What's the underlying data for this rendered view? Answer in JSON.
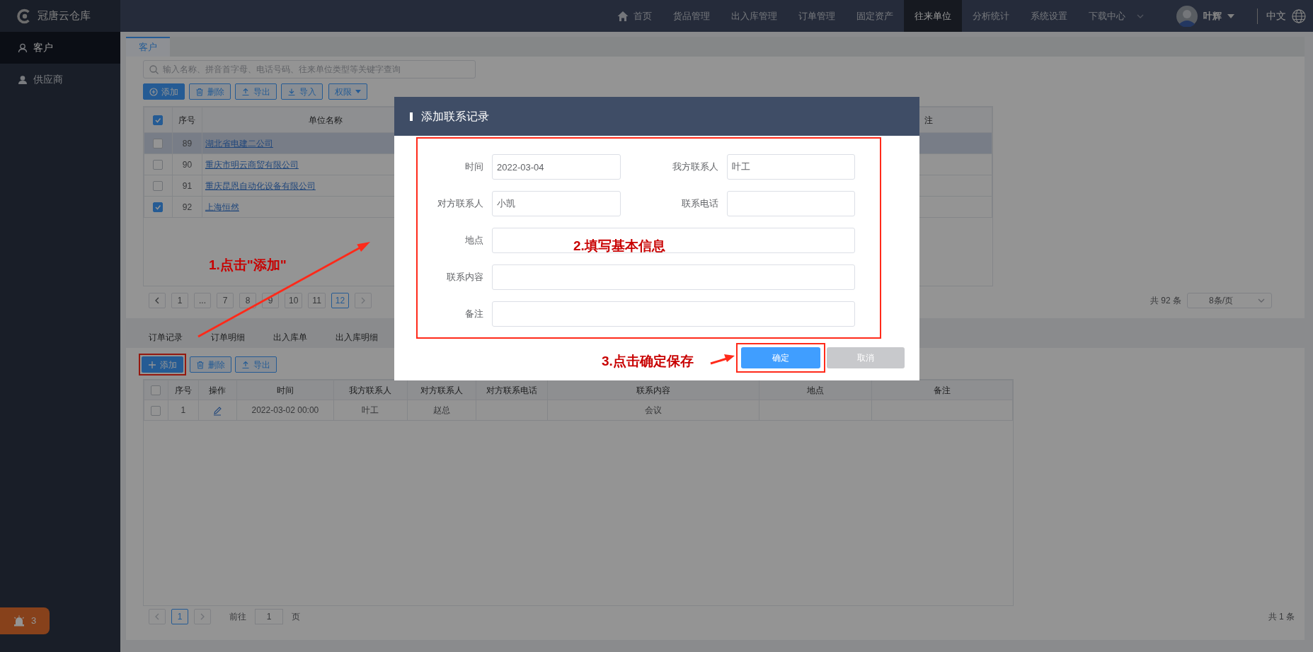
{
  "brand": {
    "name": "冠唐云仓库"
  },
  "nav": {
    "items": [
      {
        "label": "首页",
        "kind": "home",
        "selected": false
      },
      {
        "label": "货品管理",
        "kind": "plain",
        "selected": false
      },
      {
        "label": "出入库管理",
        "kind": "plain",
        "selected": false
      },
      {
        "label": "订单管理",
        "kind": "plain",
        "selected": false
      },
      {
        "label": "固定资产",
        "kind": "plain",
        "selected": false
      },
      {
        "label": "往来单位",
        "kind": "plain",
        "selected": true
      },
      {
        "label": "分析统计",
        "kind": "plain",
        "selected": false
      },
      {
        "label": "系统设置",
        "kind": "plain",
        "selected": false
      },
      {
        "label": "下载中心",
        "kind": "dropdown",
        "selected": false
      }
    ]
  },
  "user": {
    "name": "叶辉"
  },
  "language": {
    "label": "中文"
  },
  "sidebar": {
    "items": [
      {
        "label": "客户",
        "kind": "outline",
        "selected": true
      },
      {
        "label": "供应商",
        "kind": "filled",
        "selected": false
      }
    ]
  },
  "alert_badge": {
    "count": "3"
  },
  "top_panel": {
    "tabs": [
      {
        "label": "客户",
        "selected": true
      }
    ],
    "search": {
      "placeholder": "输入名称、拼音首字母、电话号码、往来单位类型等关键字查询"
    },
    "toolbar": [
      {
        "label": "添加",
        "kind": "add"
      },
      {
        "label": "删除",
        "kind": "delete"
      },
      {
        "label": "导出",
        "kind": "export"
      },
      {
        "label": "导入",
        "kind": "import"
      },
      {
        "label": "权限",
        "kind": "dropdown"
      }
    ],
    "table": {
      "header_checked": true,
      "columns": [
        "序号",
        "单位名称",
        "注"
      ],
      "rows": [
        {
          "checked": false,
          "selected": true,
          "index": "89",
          "name": "湖北省电建二公司"
        },
        {
          "checked": false,
          "selected": false,
          "index": "90",
          "name": "重庆市明云商贸有限公司"
        },
        {
          "checked": false,
          "selected": false,
          "index": "91",
          "name": "重庆昆恩自动化设备有限公司"
        },
        {
          "checked": true,
          "selected": false,
          "index": "92",
          "name": "上海恒然"
        }
      ]
    },
    "pagination": {
      "pages": [
        {
          "label": "1",
          "selected": false
        },
        {
          "label": "...",
          "selected": false
        },
        {
          "label": "7",
          "selected": false
        },
        {
          "label": "8",
          "selected": false
        },
        {
          "label": "9",
          "selected": false
        },
        {
          "label": "10",
          "selected": false
        },
        {
          "label": "11",
          "selected": false
        },
        {
          "label": "12",
          "selected": true
        }
      ],
      "total": "共 92 条",
      "page_size": "8条/页"
    }
  },
  "bottom_panel": {
    "tabs": [
      "订单记录",
      "订单明细",
      "出入库单",
      "出入库明细"
    ],
    "toolbar": [
      {
        "label": "添加",
        "kind": "plus"
      },
      {
        "label": "删除",
        "kind": "delete"
      },
      {
        "label": "导出",
        "kind": "export"
      }
    ],
    "table": {
      "header_checked": false,
      "columns": [
        "序号",
        "操作",
        "时间",
        "我方联系人",
        "对方联系人",
        "对方联系电话",
        "联系内容",
        "地点",
        "备注"
      ],
      "rows": [
        {
          "checked": false,
          "index": "1",
          "time": "2022-03-02 00:00",
          "our_contact": "叶工",
          "their_contact": "赵总",
          "content": "会议"
        }
      ]
    },
    "pagination": {
      "pages": [
        {
          "label": "1",
          "selected": true
        }
      ],
      "goto_label": "前往",
      "goto_value": "1",
      "goto_unit": "页",
      "total": "共 1 条"
    }
  },
  "modal": {
    "title": "添加联系记录",
    "fields": [
      {
        "label": "时间",
        "value": "2022-03-04",
        "kind": "half"
      },
      {
        "label": "我方联系人",
        "value": "叶工",
        "kind": "half"
      },
      {
        "label": "对方联系人",
        "value": "小凯",
        "kind": "half"
      },
      {
        "label": "联系电话",
        "kind": "half"
      },
      {
        "label": "地点",
        "kind": "full"
      },
      {
        "label": "联系内容",
        "kind": "full"
      },
      {
        "label": "备注",
        "kind": "full"
      }
    ],
    "buttons": [
      {
        "label": "确定",
        "kind": "primary"
      },
      {
        "label": "取消",
        "kind": "secondary"
      }
    ]
  },
  "annotations": [
    {
      "text": "1.点击\"添加\""
    },
    {
      "text": "2.填写基本信息"
    },
    {
      "text": "3.点击确定保存"
    }
  ]
}
